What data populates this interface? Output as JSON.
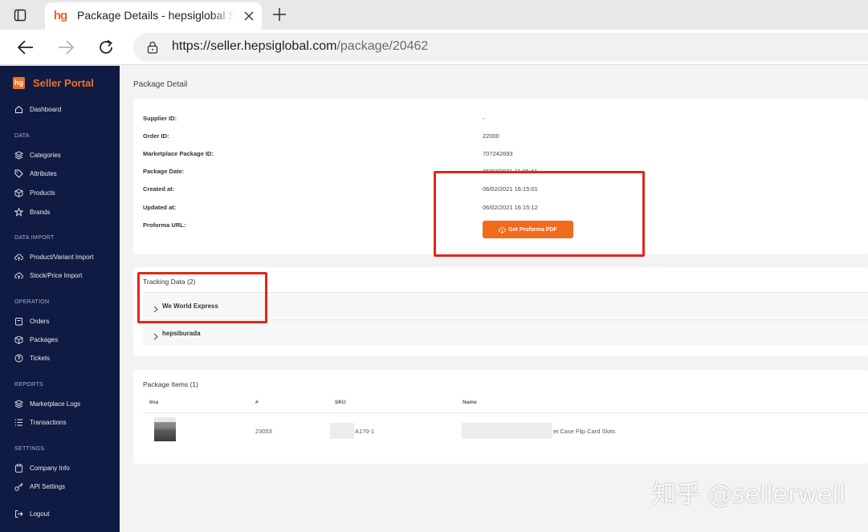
{
  "browser": {
    "tab_title": "Package Details - hepsiglobal Seller Portal",
    "favicon_text": "hg",
    "url_host": "https://seller.hepsiglobal.com",
    "url_path": "/package/20462"
  },
  "sidebar": {
    "logo_text": "hg",
    "brand": "Seller Portal",
    "dashboard": "Dashboard",
    "sections": {
      "data": "DATA",
      "data_import": "DATA IMPORT",
      "operation": "OPERATION",
      "reports": "REPORTS",
      "settings": "SETTINGS"
    },
    "items": {
      "categories": "Categories",
      "attributes": "Attributes",
      "products": "Products",
      "brands": "Brands",
      "product_import": "Product/Variant Import",
      "stock_import": "Stock/Price Import",
      "orders": "Orders",
      "packages": "Packages",
      "tickets": "Tickets",
      "marketplace_logs": "Marketplace Logs",
      "transactions": "Transactions",
      "company_info": "Company Info",
      "api_settings": "API Settings",
      "logout": "Logout"
    }
  },
  "main": {
    "page_title": "Package Detail",
    "detail": {
      "supplier_id_label": "Supplier ID:",
      "supplier_id": "-",
      "order_id_label": "Order ID:",
      "order_id": "22000",
      "mkt_pkg_label": "Marketplace Package ID:",
      "mkt_pkg": "707242693",
      "pkg_date_label": "Package Date:",
      "pkg_date": "06/02/2021 11:26:41",
      "created_label": "Created at:",
      "created": "06/02/2021 16:15:01",
      "updated_label": "Updated at:",
      "updated": "06/02/2021 16:15:12",
      "proforma_label": "Proforma URL:",
      "proforma_button": "Get Proforma PDF"
    },
    "tracking": {
      "title": "Tracking Data (2)",
      "items": [
        "We World Express",
        "hepsiburada"
      ]
    },
    "items": {
      "title": "Package Items (1)",
      "headers": {
        "image": "Ima",
        "num": "#",
        "sku": "SKU",
        "name": "Name"
      },
      "row": {
        "num": "23053",
        "sku": "A170-1",
        "name": "et Case Flip Card Slots"
      }
    }
  },
  "watermark": "知乎 @sellerwell",
  "colors": {
    "sidebar": "#0f1b42",
    "accent": "#f37021",
    "annotation": "#e0271a"
  }
}
